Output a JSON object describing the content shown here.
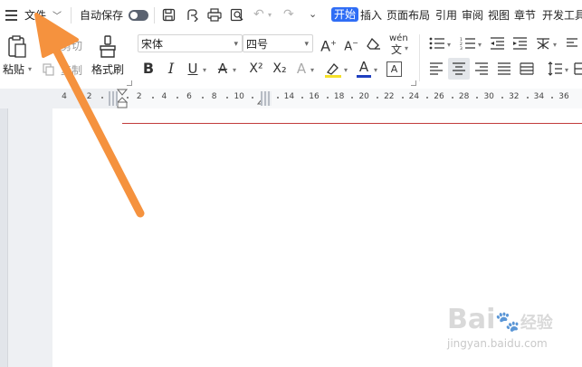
{
  "topbar": {
    "file_menu_label": "文件",
    "autosave_label": "自动保存",
    "tabs": [
      "开始",
      "插入",
      "页面布局",
      "引用",
      "审阅",
      "视图",
      "章节",
      "开发工具"
    ]
  },
  "ribbon": {
    "paste_label": "粘贴",
    "cut_label": "剪切",
    "copy_label": "复制",
    "format_painter_label": "格式刷",
    "font_name": "宋体",
    "font_size": "四号",
    "phonetic_char": "wén",
    "bold": "B",
    "italic": "I",
    "underline": "U",
    "strike": "A",
    "superscript": "X²",
    "subscript": "X₂",
    "grow_font": "A",
    "shrink_font": "A",
    "font_color": "A",
    "char_border": "A",
    "highlight_color": "#f5e028",
    "font_color_value": "#1f3fbf"
  },
  "ruler": {
    "ticks": [
      "4",
      "2",
      "",
      "2",
      "4",
      "6",
      "8",
      "10",
      "",
      "14",
      "16",
      "18",
      "20",
      "22",
      "24",
      "26",
      "28",
      "30",
      "32",
      "34",
      "36"
    ]
  },
  "watermark": {
    "brand": "Bai",
    "brand_suffix": "经验",
    "url": "jingyan.baidu.com"
  },
  "colors": {
    "accent": "#2f6df5",
    "arrow": "#f5923e",
    "margin_line": "#c23b3b"
  }
}
